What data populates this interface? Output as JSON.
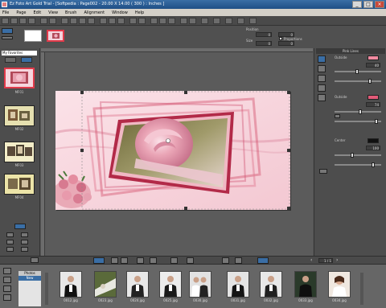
{
  "window": {
    "title": "Ez Foto Art Gold Trial - [Softpedia : Page002 - 20.00 X 14.00 ( 300 ) : Inches ]",
    "minimize": "_",
    "maximize": "□",
    "close": "×"
  },
  "menu": [
    "File",
    "Page",
    "Edit",
    "View",
    "Brush",
    "Alignment",
    "Window",
    "Help"
  ],
  "toolbar_icons": [
    "new-icon",
    "open-icon",
    "save-icon",
    "print-icon",
    "undo-icon",
    "redo-icon",
    "cut-icon",
    "copy-icon",
    "paste-icon",
    "delete-icon",
    "crop-icon",
    "rotate-icon",
    "flip-icon",
    "text-icon",
    "brush-icon",
    "zoom-in-icon",
    "zoom-out-icon",
    "hand-icon",
    "fit-icon",
    "grid-icon",
    "order-icon",
    "group-icon",
    "lock-icon",
    "eyedrop-icon",
    "frame-icon"
  ],
  "props": {
    "position_label": "Position",
    "size_label": "Size",
    "proportions_label": "Proportions",
    "pos_x": "0",
    "pos_y": "0",
    "size_w": "0",
    "size_h": "0"
  },
  "left_panel": {
    "select_value": "My Favorites",
    "layouts": [
      {
        "label": "MF01"
      },
      {
        "label": "MF02"
      },
      {
        "label": "MF03"
      },
      {
        "label": "MF04"
      }
    ]
  },
  "right_panel": {
    "title": "Pink Lines",
    "groups": [
      {
        "label": "Outside",
        "value": "40"
      },
      {
        "label": "Outside",
        "value": "74"
      },
      {
        "label": "Center",
        "value": "100"
      }
    ]
  },
  "status": "Softpedia - Page002 -",
  "bottom": {
    "page_counter": "1 / 1"
  },
  "filmstrip": {
    "list_header": "Photos",
    "list_item": "New",
    "photos": [
      {
        "caption": "0012.jpg"
      },
      {
        "caption": "0023.jpg"
      },
      {
        "caption": "0024.jpg"
      },
      {
        "caption": "0025.jpg"
      },
      {
        "caption": "0030.jpg"
      },
      {
        "caption": "0031.jpg"
      },
      {
        "caption": "0032.jpg"
      },
      {
        "caption": "0033.jpg"
      },
      {
        "caption": "0034.jpg"
      },
      {
        "caption": "0035.jpg"
      }
    ]
  },
  "colors": {
    "accent": "#e03a4a",
    "page_bg": "#f7d5dd",
    "frame": "#c42e4a"
  }
}
